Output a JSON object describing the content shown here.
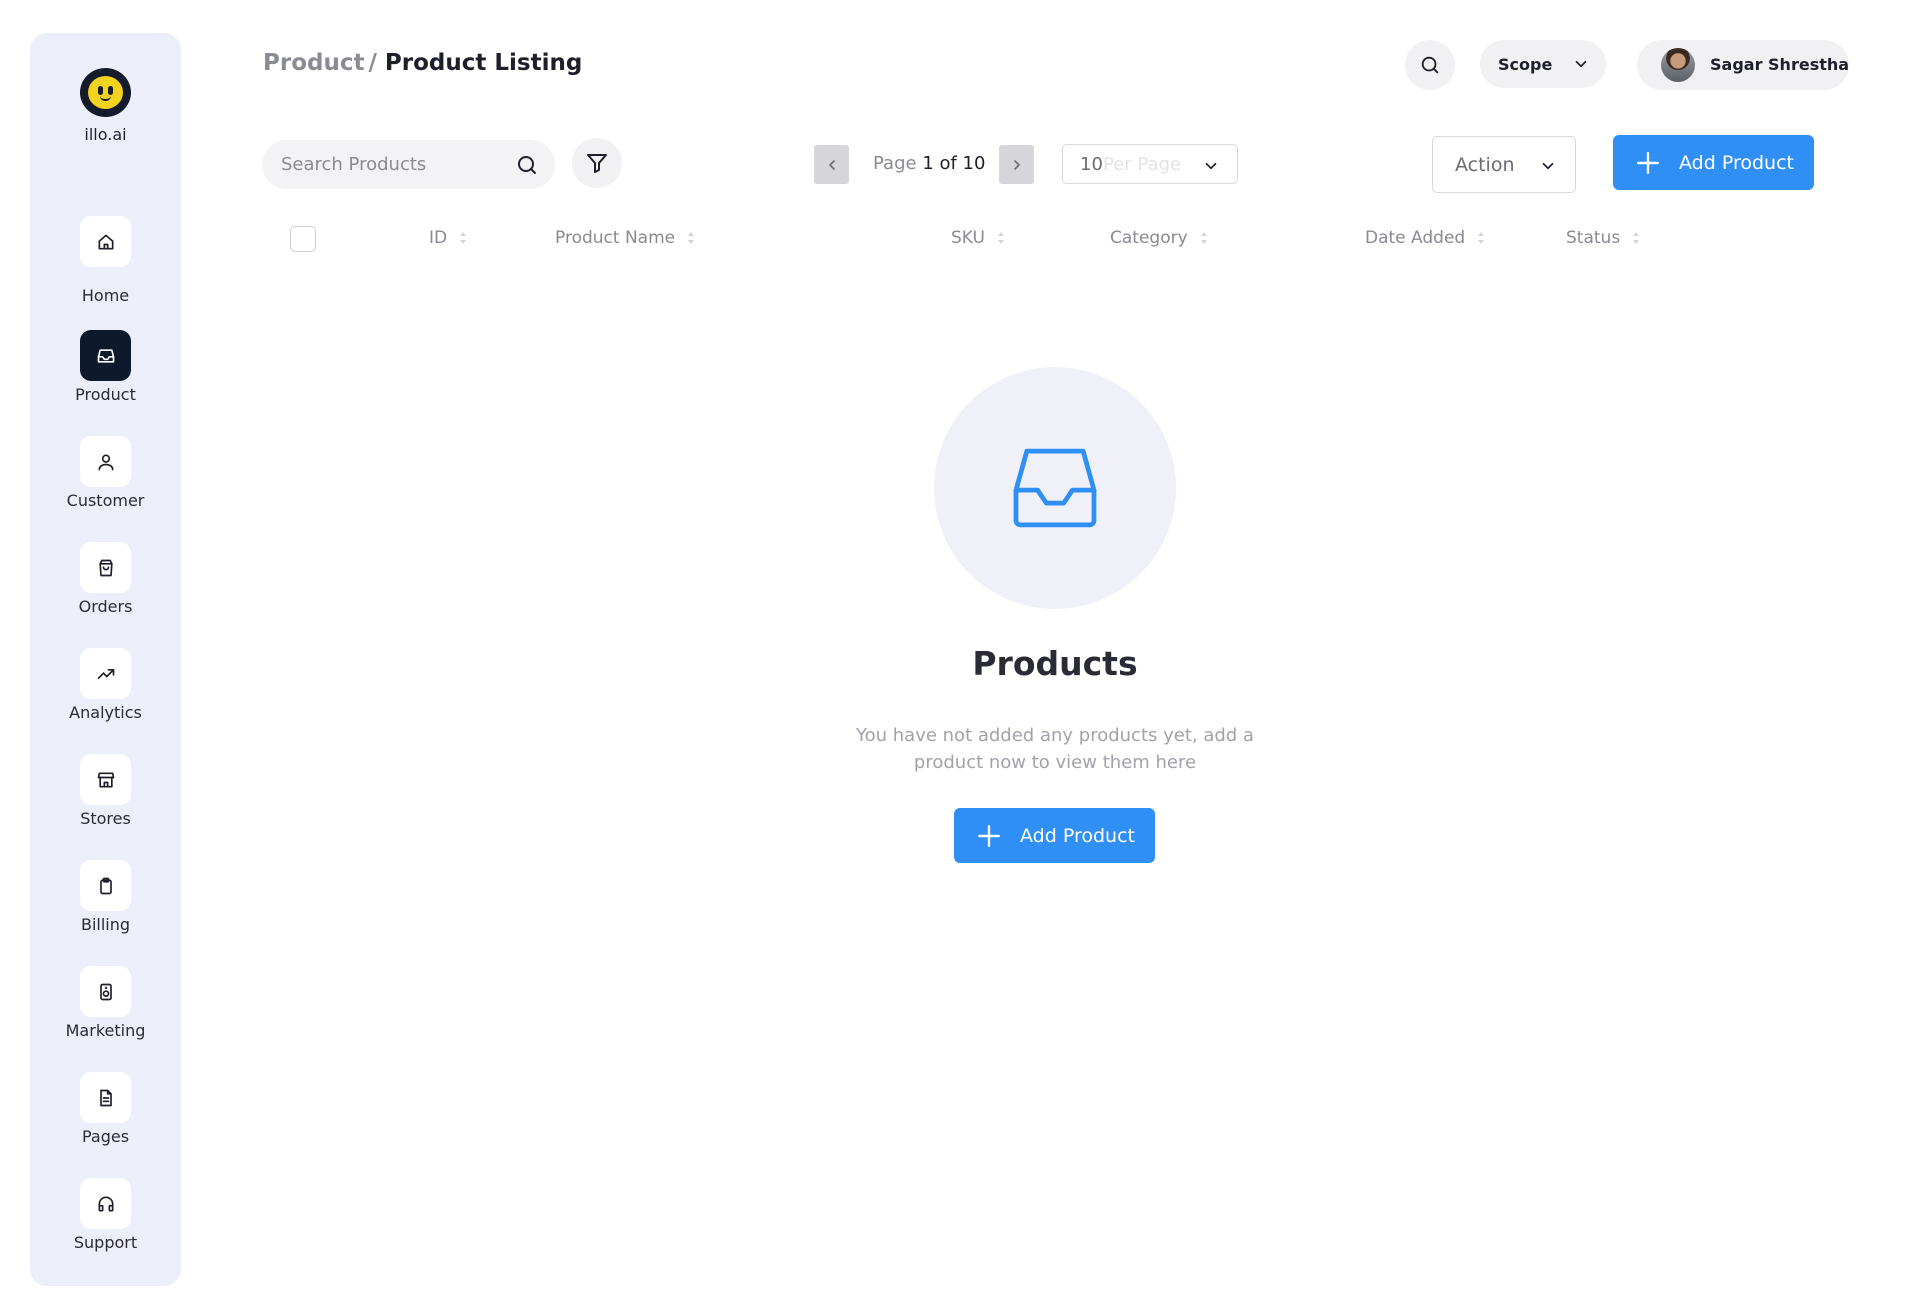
{
  "brand": {
    "name": "illo.ai"
  },
  "sidebar": {
    "items": [
      {
        "label": "Home",
        "icon": "home-icon",
        "active": false
      },
      {
        "label": "Product",
        "icon": "inbox-icon",
        "active": true
      },
      {
        "label": "Customer",
        "icon": "user-icon",
        "active": false
      },
      {
        "label": "Orders",
        "icon": "shopping-bag-icon",
        "active": false
      },
      {
        "label": "Analytics",
        "icon": "trending-up-icon",
        "active": false
      },
      {
        "label": "Stores",
        "icon": "store-icon",
        "active": false
      },
      {
        "label": "Billing",
        "icon": "clipboard-icon",
        "active": false
      },
      {
        "label": "Marketing",
        "icon": "speaker-icon",
        "active": false
      },
      {
        "label": "Pages",
        "icon": "document-icon",
        "active": false
      },
      {
        "label": "Support",
        "icon": "headphones-icon",
        "active": false
      }
    ]
  },
  "header": {
    "breadcrumb_parent": "Product",
    "breadcrumb_separator": "/",
    "breadcrumb_current": "Product Listing",
    "scope_label": "Scope",
    "user_name": "Sagar Shrestha"
  },
  "toolbar": {
    "search_placeholder": "Search Products",
    "page_word": "Page",
    "page_current": "1 of 10",
    "per_page_count": "10",
    "per_page_suffix": "Per Page",
    "action_label": "Action",
    "add_product_label": "Add Product"
  },
  "table": {
    "columns": [
      "ID",
      "Product Name",
      "SKU",
      "Category",
      "Date Added",
      "Status"
    ]
  },
  "empty_state": {
    "title": "Products",
    "message": "You have not added any products yet, add a product now to view them here",
    "button_label": "Add Product"
  },
  "colors": {
    "accent": "#2f8ff5",
    "sidebar_bg": "#eceef9",
    "active_nav": "#0e1a2b",
    "empty_circle": "#f0f1f8"
  }
}
